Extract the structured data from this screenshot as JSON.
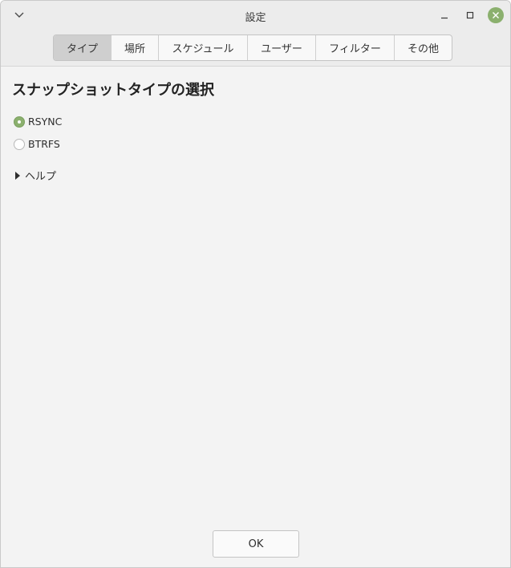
{
  "window": {
    "title": "設定"
  },
  "tabs": [
    {
      "label": "タイプ",
      "active": true
    },
    {
      "label": "場所",
      "active": false
    },
    {
      "label": "スケジュール",
      "active": false
    },
    {
      "label": "ユーザー",
      "active": false
    },
    {
      "label": "フィルター",
      "active": false
    },
    {
      "label": "その他",
      "active": false
    }
  ],
  "section": {
    "heading": "スナップショットタイプの選択",
    "options": [
      {
        "label": "RSYNC",
        "selected": true
      },
      {
        "label": "BTRFS",
        "selected": false
      }
    ],
    "help_expander": "ヘルプ"
  },
  "footer": {
    "ok_label": "OK"
  },
  "colors": {
    "accent": "#8bb06e",
    "active_tab": "#cfcfcf",
    "background": "#f3f3f3"
  }
}
